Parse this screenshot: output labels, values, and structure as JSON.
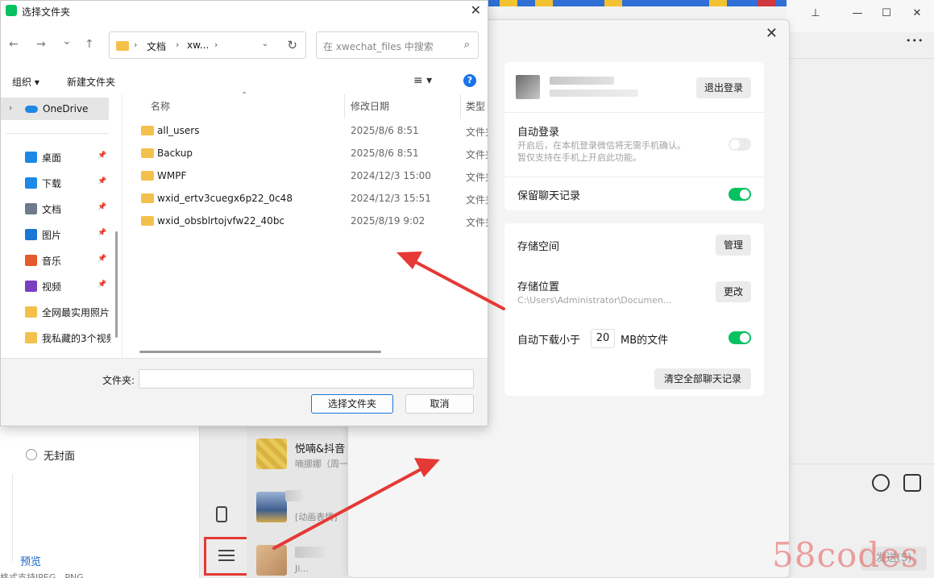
{
  "dialog": {
    "title": "选择文件夹",
    "close": "✕",
    "nav": {
      "back": "←",
      "forward": "→",
      "recent": "⌄",
      "up": "↑"
    },
    "breadcrumb": [
      "文档",
      "xw..."
    ],
    "search_placeholder": "在 xwechat_files 中搜索",
    "toolbar": {
      "organize": "组织 ▾",
      "new_folder": "新建文件夹",
      "help": "?"
    },
    "nav_pane": {
      "onedrive": "OneDrive",
      "items": [
        {
          "label": "桌面",
          "color": "#1e88e5",
          "pinned": true
        },
        {
          "label": "下载",
          "color": "#1e88e5",
          "pinned": true
        },
        {
          "label": "文档",
          "color": "#6d7b8c",
          "pinned": true
        },
        {
          "label": "图片",
          "color": "#1976d2",
          "pinned": true
        },
        {
          "label": "音乐",
          "color": "#e65a2d",
          "pinned": true
        },
        {
          "label": "视频",
          "color": "#7b3fbf",
          "pinned": true
        },
        {
          "label": "全网最实用照片",
          "color": "#f3c14b",
          "pinned": false
        },
        {
          "label": "我私藏的3个视频",
          "color": "#f3c14b",
          "pinned": false
        }
      ]
    },
    "columns": {
      "name": "名称",
      "date": "修改日期",
      "type": "类型"
    },
    "files": [
      {
        "name": "all_users",
        "date": "2025/8/6 8:51",
        "type": "文件夹"
      },
      {
        "name": "Backup",
        "date": "2025/8/6 8:51",
        "type": "文件夹"
      },
      {
        "name": "WMPF",
        "date": "2024/12/3 15:00",
        "type": "文件夹"
      },
      {
        "name": "wxid_ertv3cuegx6p22_0c48",
        "date": "2024/12/3 15:51",
        "type": "文件夹"
      },
      {
        "name": "wxid_obsblrtojvfw22_40bc",
        "date": "2025/8/19 9:02",
        "type": "文件夹"
      }
    ],
    "folder_label": "文件夹:",
    "folder_value": "",
    "select_button": "选择文件夹",
    "cancel_button": "取消"
  },
  "settings": {
    "close": "✕",
    "logout_button": "退出登录",
    "auto_login": {
      "label": "自动登录",
      "desc1": "开启后，在本机登录微信将无需手机确认。",
      "desc2": "暂仅支持在手机上开启此功能。",
      "on": false
    },
    "keep_history": {
      "label": "保留聊天记录",
      "on": true
    },
    "storage_space": {
      "label": "存储空间",
      "button": "管理"
    },
    "storage_location": {
      "label": "存储位置",
      "path": "C:\\Users\\Administrator\\Documen...",
      "button": "更改"
    },
    "auto_download": {
      "prefix": "自动下载小于",
      "value": "20",
      "suffix": "MB的文件",
      "on": true
    },
    "clear_button": "清空全部聊天记录"
  },
  "background": {
    "window_controls": {
      "pin": "⊥",
      "minimize": "—",
      "maximize": "☐",
      "close": "✕",
      "more": "•••"
    },
    "no_cover": "无封面",
    "preview": "预览",
    "format_hint": "格式支持JPEG、PNG",
    "chats": [
      {
        "name": "悦喃&抖音",
        "message": "喃挪娜（周一"
      },
      {
        "name": "",
        "message": "[动画表情]"
      },
      {
        "name": "",
        "message": "Ji..."
      }
    ],
    "send_button": "发送(S)"
  },
  "watermark": "58codes",
  "colors": {
    "accent_green": "#07c160",
    "highlight_red": "#e53935",
    "link_blue": "#2f6fb6"
  }
}
